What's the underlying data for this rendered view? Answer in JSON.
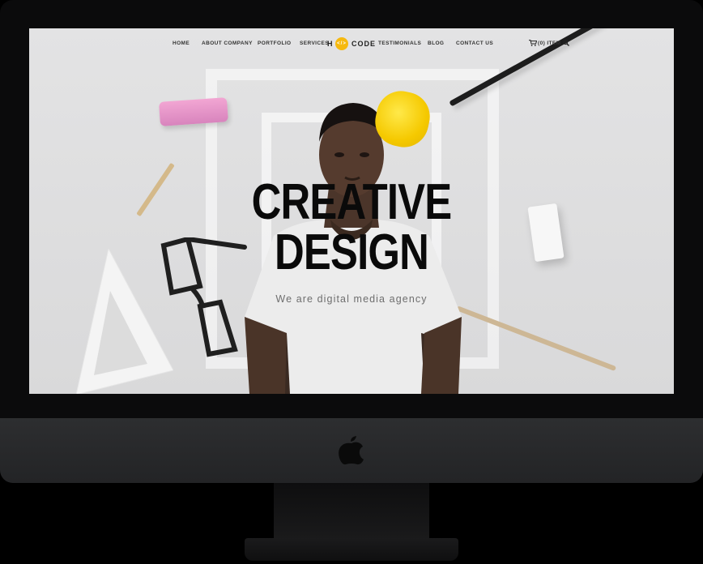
{
  "nav": {
    "items": [
      "HOME",
      "ABOUT COMPANY",
      "PORTFOLIO",
      "SERVICES",
      "TESTIMONIALS",
      "BLOG",
      "CONTACT US"
    ],
    "logo_left": "H",
    "logo_mark": "</>",
    "logo_right": "CODE",
    "cart_label": "(0) ITEM",
    "cart_icon": "cart-icon",
    "search_icon": "search-icon"
  },
  "hero": {
    "title_line1": "CREATIVE",
    "title_line2": "DESIGN",
    "subtitle": "We are digital media agency"
  },
  "colors": {
    "accent": "#f6b90f",
    "screen_bg": "#dedede",
    "title": "#0a0a0a",
    "bezel": "#0b0b0c"
  }
}
